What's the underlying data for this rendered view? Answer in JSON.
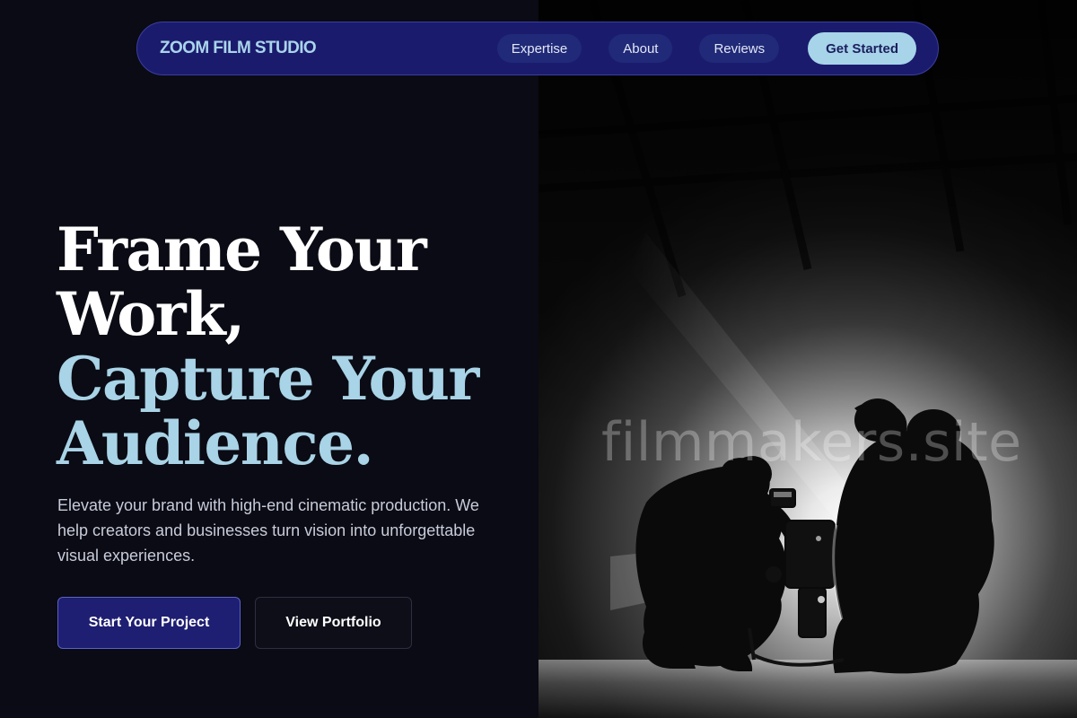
{
  "nav": {
    "brand": "ZOOM FILM STUDIO",
    "links": [
      {
        "label": "Expertise"
      },
      {
        "label": "About"
      },
      {
        "label": "Reviews"
      }
    ],
    "cta": "Get Started"
  },
  "hero": {
    "heading_lines": [
      "Frame Your",
      "Work,"
    ],
    "heading_accent_lines": [
      "Capture Your",
      "Audience."
    ],
    "subtitle": "Elevate your brand with high-end cinematic production. We help creators and businesses turn vision into unforgettable visual experiences.",
    "primary_button": "Start Your Project",
    "secondary_button": "View Portfolio",
    "image_watermark": "filmmakers.site",
    "image_description_icon": "film-crew-photo"
  },
  "colors": {
    "background": "#0a0b14",
    "navbar": "#1b1b6e",
    "accent": "#a9d3e6",
    "primary_button": "#1e1e72"
  }
}
